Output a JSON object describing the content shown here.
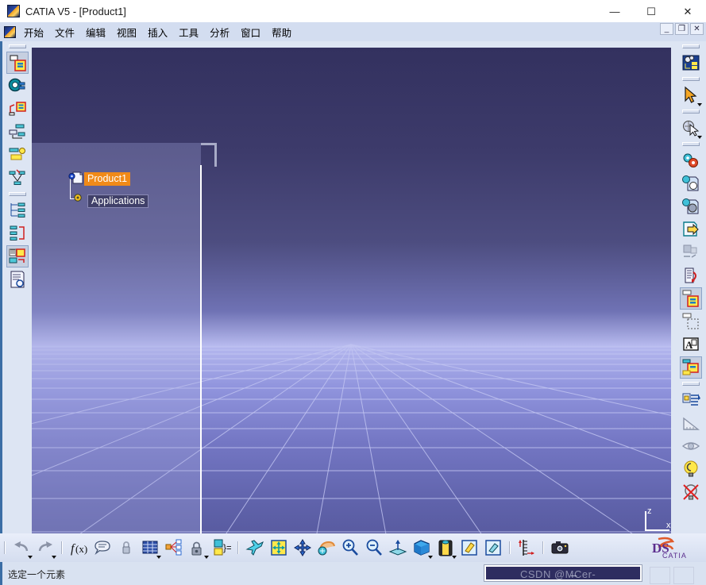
{
  "window": {
    "title": "CATIA V5 - [Product1]",
    "app_icon": "catia-logo-icon",
    "controls": [
      {
        "name": "minimize-button",
        "glyph": "—"
      },
      {
        "name": "maximize-button",
        "glyph": "☐"
      },
      {
        "name": "close-button",
        "glyph": "✕"
      }
    ],
    "mdi_controls": [
      {
        "name": "mdi-minimize-button",
        "glyph": "_"
      },
      {
        "name": "mdi-restore-button",
        "glyph": "❐"
      },
      {
        "name": "mdi-close-button",
        "glyph": "✕"
      }
    ]
  },
  "menubar": {
    "items": [
      {
        "label": "开始",
        "name": "menu-start"
      },
      {
        "label": "文件",
        "name": "menu-file"
      },
      {
        "label": "编辑",
        "name": "menu-edit"
      },
      {
        "label": "视图",
        "name": "menu-view"
      },
      {
        "label": "插入",
        "name": "menu-insert"
      },
      {
        "label": "工具",
        "name": "menu-tools"
      },
      {
        "label": "分析",
        "name": "menu-analyze"
      },
      {
        "label": "窗口",
        "name": "menu-window"
      },
      {
        "label": "帮助",
        "name": "menu-help"
      }
    ]
  },
  "left_toolbar": {
    "items": [
      {
        "name": "product-structure-tools-icon",
        "active": true
      },
      {
        "name": "catalog-browser-icon",
        "active": false
      },
      {
        "name": "existing-component-icon",
        "active": false
      },
      {
        "name": "replace-component-icon",
        "active": false
      },
      {
        "name": "generate-numbering-icon",
        "active": false
      },
      {
        "name": "graph-tree-reorder-icon",
        "active": false
      },
      {
        "name": "fast-multi-instantiation-icon",
        "active": false
      },
      {
        "name": "define-multi-instantiation-icon",
        "active": false
      },
      {
        "name": "reuse-pattern-icon",
        "active": true
      },
      {
        "name": "bill-of-material-icon",
        "active": false
      }
    ]
  },
  "right_toolbar": {
    "items": [
      {
        "name": "assembly-features-icon",
        "active": false
      },
      {
        "name": "select-arrow-icon",
        "active": false,
        "caret": true
      },
      {
        "name": "select-scene-icon",
        "active": false,
        "caret": true
      },
      {
        "name": "update-all-icon",
        "active": false
      },
      {
        "name": "manage-representations-icon",
        "active": false
      },
      {
        "name": "apply-material-icon",
        "active": false
      },
      {
        "name": "export-data-icon",
        "active": false
      },
      {
        "name": "paste-special-icon",
        "active": false
      },
      {
        "name": "scene-browser-icon",
        "active": false
      },
      {
        "name": "enhanced-scene-icon",
        "active": true
      },
      {
        "name": "flexible-rigid-icon",
        "active": false
      },
      {
        "name": "selection-set-icon",
        "active": false
      },
      {
        "name": "annotation-text-icon",
        "active": false
      },
      {
        "name": "catalog-icon",
        "active": true
      },
      {
        "name": "exploded-view-icon",
        "active": false
      },
      {
        "name": "measure-item-icon",
        "active": false
      },
      {
        "name": "clash-detection-icon",
        "active": false
      },
      {
        "name": "lamp-highlight-icon",
        "active": false
      },
      {
        "name": "no-lamp-icon",
        "active": false
      }
    ]
  },
  "bottom_toolbar": {
    "items": [
      {
        "type": "sep"
      },
      {
        "name": "undo-button",
        "caret": true
      },
      {
        "name": "redo-button",
        "caret": true
      },
      {
        "type": "sep"
      },
      {
        "name": "formula-button"
      },
      {
        "name": "comment-button"
      },
      {
        "name": "lock-small-button"
      },
      {
        "name": "design-table-button",
        "caret": true
      },
      {
        "name": "knowledge-inspector-button"
      },
      {
        "name": "optimization-button",
        "caret": true
      },
      {
        "type": "sep"
      },
      {
        "name": "fly-mode-button"
      },
      {
        "name": "fit-all-in-button"
      },
      {
        "name": "pan-button"
      },
      {
        "name": "rotate-button"
      },
      {
        "name": "zoom-in-button"
      },
      {
        "name": "zoom-out-button"
      },
      {
        "name": "normal-view-button"
      },
      {
        "name": "isometric-view-button",
        "caret": true
      },
      {
        "name": "render-style-button",
        "caret": true
      },
      {
        "name": "hide-show-button"
      },
      {
        "name": "swap-visible-space-button"
      },
      {
        "type": "sep"
      },
      {
        "name": "measure-between-button"
      },
      {
        "type": "sep"
      },
      {
        "name": "capture-camera-button"
      }
    ],
    "logo_text_top": "DS",
    "logo_text_bottom": "CATIA"
  },
  "viewport": {
    "tree": {
      "root": {
        "label": "Product1",
        "icon": "product-document-icon",
        "selected": true
      },
      "child": {
        "label": "Applications",
        "icon": "applications-gear-icon",
        "selected": false
      }
    },
    "axis": {
      "z_label": "z",
      "x_label": "x"
    }
  },
  "statusbar": {
    "message": "选定一个元素",
    "input_value": "",
    "watermark": "CSDN @M̶̶Cer-"
  },
  "colors": {
    "selection_orange": "#f08a18",
    "accent_blue": "#3b6ea5",
    "viewport_sky_top": "#33315f",
    "viewport_horizon": "#b9bcf0",
    "input_navy": "#2e2d60"
  }
}
